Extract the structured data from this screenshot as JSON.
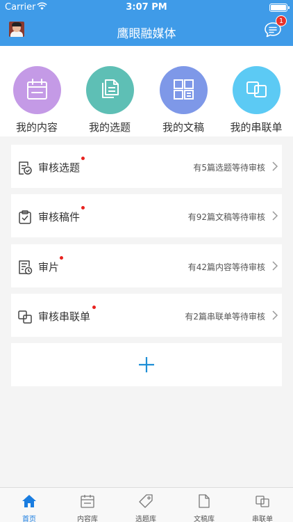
{
  "status_bar": {
    "carrier": "Carrier",
    "time": "3:07 PM"
  },
  "nav": {
    "title": "鹰眼融媒体",
    "message_badge": "1"
  },
  "quick_actions": [
    {
      "label": "我的内容",
      "icon": "calendar-icon",
      "color": "#c49ae6"
    },
    {
      "label": "我的选题",
      "icon": "documents-icon",
      "color": "#5ebfb5"
    },
    {
      "label": "我的文稿",
      "icon": "grid-document-icon",
      "color": "#7e98e8"
    },
    {
      "label": "我的串联单",
      "icon": "link-squares-icon",
      "color": "#5ccaf4"
    }
  ],
  "reviews": [
    {
      "title": "审核选题",
      "info": "有5篇选题等待审核",
      "icon": "topic-review-icon"
    },
    {
      "title": "审核稿件",
      "info": "有92篇文稿等待审核",
      "icon": "clipboard-check-icon"
    },
    {
      "title": "审片",
      "info": "有42篇内容等待审核",
      "icon": "film-review-icon"
    },
    {
      "title": "审核串联单",
      "info": "有2篇串联单等待审核",
      "icon": "link-review-icon"
    }
  ],
  "tabs": [
    {
      "label": "首页",
      "icon": "home-icon",
      "active": true
    },
    {
      "label": "内容库",
      "icon": "calendar-icon"
    },
    {
      "label": "选题库",
      "icon": "tag-icon"
    },
    {
      "label": "文稿库",
      "icon": "document-icon"
    },
    {
      "label": "串联单",
      "icon": "link-squares-icon"
    }
  ],
  "colors": {
    "primary": "#3f9be8",
    "tab_active": "#1a7de0",
    "notification_dot": "#e8221f",
    "add_plus": "#1f8fd6"
  }
}
